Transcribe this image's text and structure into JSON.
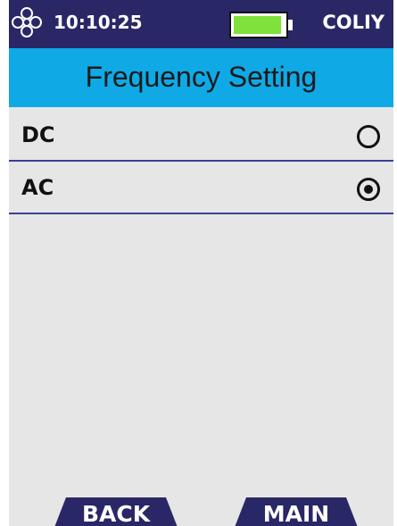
{
  "status": {
    "time": "10:10:25",
    "brand": "COLIY",
    "battery_level": 0.95,
    "battery_color": "#7fe13a",
    "logo_icon": "flower-logo-icon"
  },
  "header": {
    "title": "Frequency Setting"
  },
  "options": [
    {
      "label": "DC",
      "selected": false
    },
    {
      "label": "AC",
      "selected": true
    }
  ],
  "softkeys": {
    "back_label": "BACK",
    "main_label": "MAIN"
  },
  "colors": {
    "statusbar": "#2a2767",
    "titlebar": "#0fa9e6",
    "background": "#e6e6e6",
    "softkey": "#2a2767",
    "divider": "#3a3f99"
  }
}
